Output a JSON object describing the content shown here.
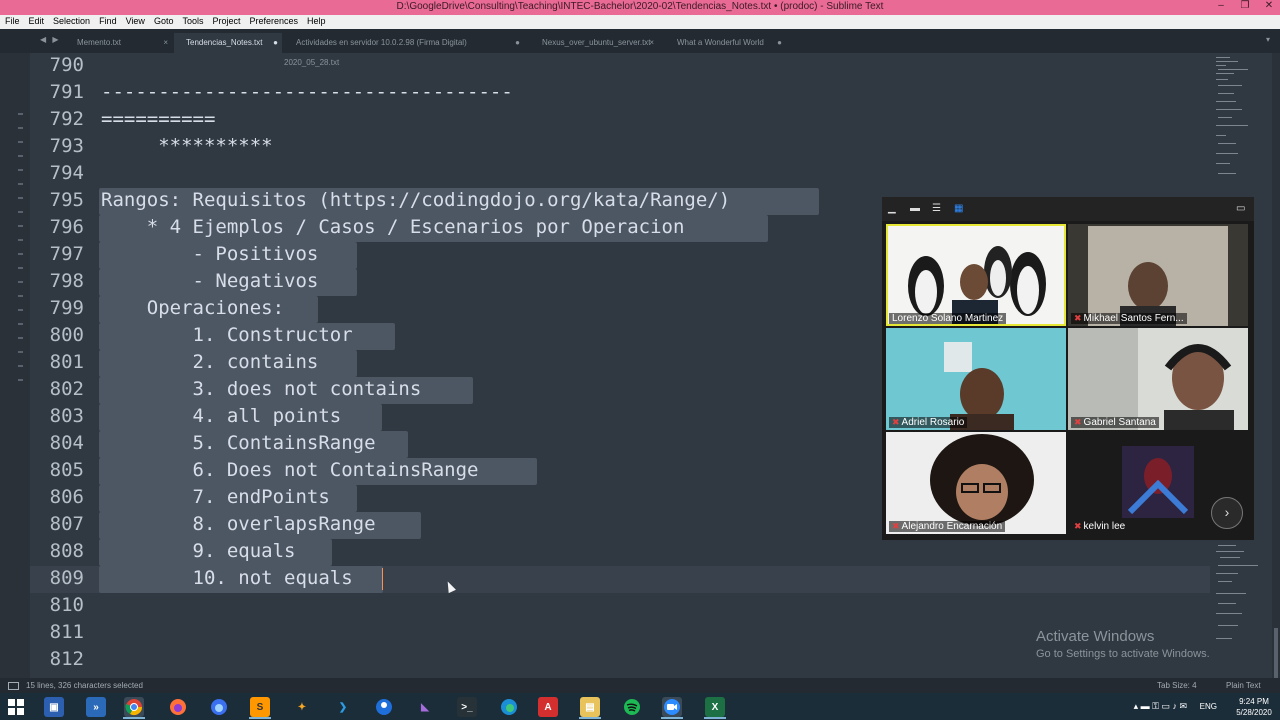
{
  "window": {
    "title": "D:\\GoogleDrive\\Consulting\\Teaching\\INTEC-Bachelor\\2020-02\\Tendencias_Notes.txt • (prodoc) - Sublime Text",
    "controls": [
      "–",
      "❐",
      "✕"
    ]
  },
  "menu": [
    "File",
    "Edit",
    "Selection",
    "Find",
    "View",
    "Goto",
    "Tools",
    "Project",
    "Preferences",
    "Help"
  ],
  "tabs": [
    {
      "label": "Memento.txt",
      "close": "×"
    },
    {
      "label": "Tendencias_Notes.txt",
      "close": "●"
    },
    {
      "label": "Actividades en servidor 10.0.2.98 (Firma Digital) 2020_05_28.txt",
      "close": "●"
    },
    {
      "label": "Nexus_over_ubuntu_server.txt",
      "close": "×"
    },
    {
      "label": "What a Wonderful World",
      "close": "●"
    }
  ],
  "tab_nav": "◀ ▶",
  "tab_menu": "▾",
  "editor": {
    "lines": [
      {
        "num": "790",
        "text": ""
      },
      {
        "num": "791",
        "text": "------------------------------------"
      },
      {
        "num": "792",
        "text": "=========="
      },
      {
        "num": "793",
        "text": "     **********"
      },
      {
        "num": "794",
        "text": ""
      },
      {
        "num": "795",
        "text": "Rangos: Requisitos (https://codingdojo.org/kata/Range/)"
      },
      {
        "num": "796",
        "text": "    * 4 Ejemplos / Casos / Escenarios por Operacion"
      },
      {
        "num": "797",
        "text": "        - Positivos"
      },
      {
        "num": "798",
        "text": "        - Negativos"
      },
      {
        "num": "799",
        "text": "    Operaciones:"
      },
      {
        "num": "800",
        "text": "        1. Constructor"
      },
      {
        "num": "801",
        "text": "        2. contains"
      },
      {
        "num": "802",
        "text": "        3. does not contains"
      },
      {
        "num": "803",
        "text": "        4. all points"
      },
      {
        "num": "804",
        "text": "        5. ContainsRange"
      },
      {
        "num": "805",
        "text": "        6. Does not ContainsRange"
      },
      {
        "num": "806",
        "text": "        7. endPoints"
      },
      {
        "num": "807",
        "text": "        8. overlapsRange"
      },
      {
        "num": "808",
        "text": "        9. equals"
      },
      {
        "num": "809",
        "text": "        10. not equals"
      },
      {
        "num": "810",
        "text": ""
      },
      {
        "num": "811",
        "text": ""
      },
      {
        "num": "812",
        "text": ""
      }
    ]
  },
  "status": {
    "selection": "15 lines, 326 characters selected",
    "tab_size": "Tab Size: 4",
    "syntax": "Plain Text"
  },
  "activation": {
    "title": "Activate Windows",
    "subtitle": "Go to Settings to activate Windows."
  },
  "zoom": {
    "participants": [
      {
        "name": "Lorenzo Solano Martinez",
        "muted": false,
        "speaking": true
      },
      {
        "name": "Mikhael Santos Fern...",
        "muted": true,
        "speaking": false
      },
      {
        "name": "Adriel Rosario",
        "muted": true,
        "speaking": false
      },
      {
        "name": "Gabriel Santana",
        "muted": true,
        "speaking": false
      },
      {
        "name": "Alejandro Encarnación",
        "muted": true,
        "speaking": false
      },
      {
        "name": "kelvin lee",
        "muted": true,
        "speaking": false
      }
    ],
    "next_glyph": "›"
  },
  "taskbar": {
    "apps": [
      "start",
      "explorer",
      "powershell",
      "chrome",
      "firefox",
      "firefox-dev",
      "sublime-text",
      "git",
      "vscode",
      "maps",
      "visual-studio",
      "terminal",
      "edge",
      "acrobat",
      "files",
      "spotify",
      "zoom",
      "excel"
    ],
    "lang": "ENG",
    "time": "9:24 PM",
    "date": "5/28/2020"
  },
  "colors": {
    "titlebar": "#e86a95",
    "editor_bg": "#303841",
    "selection": "#4c5763",
    "cursor": "#f99157",
    "zoom_speaking": "#e6e634"
  }
}
